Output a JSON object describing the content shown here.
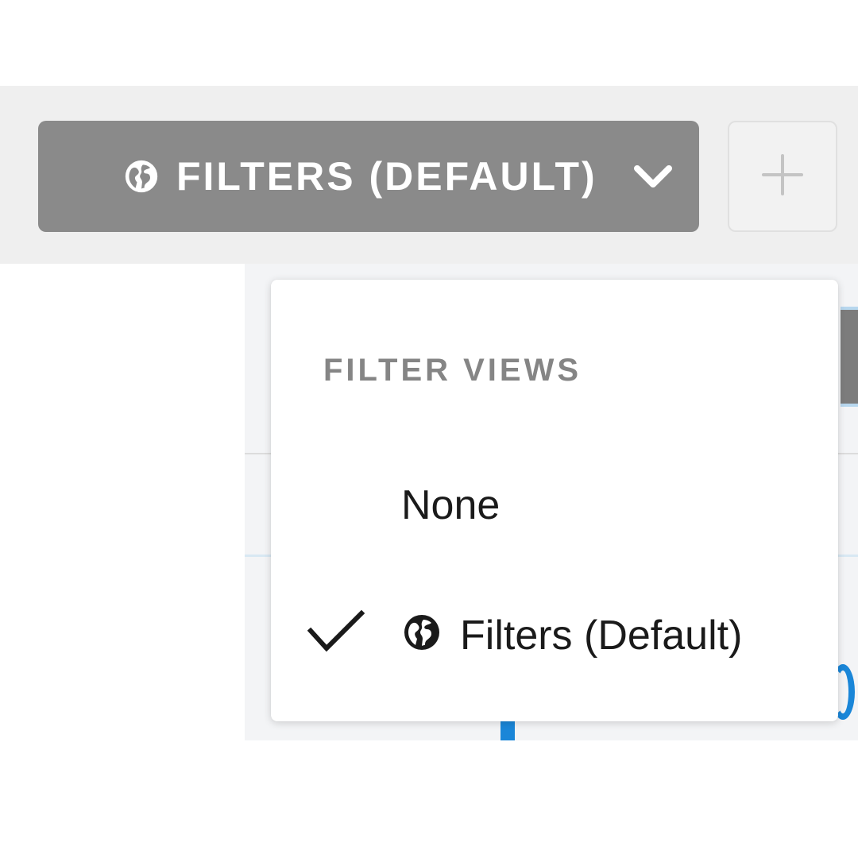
{
  "toolbar": {
    "filters_button_label": "FILTERS (DEFAULT)",
    "filters_button_icon": "globe-icon",
    "dropdown_icon": "chevron-down-icon",
    "add_button_icon": "plus-icon"
  },
  "menu": {
    "heading": "FILTER VIEWS",
    "items": [
      {
        "label": "None",
        "selected": false,
        "icon": ""
      },
      {
        "label": "Filters (Default)",
        "selected": true,
        "icon": "globe-icon"
      }
    ]
  },
  "colors": {
    "button_bg": "#8a8a8a",
    "toolbar_bg": "#efefef",
    "heading_text": "#858585",
    "accent_blue": "#1a86d8"
  }
}
